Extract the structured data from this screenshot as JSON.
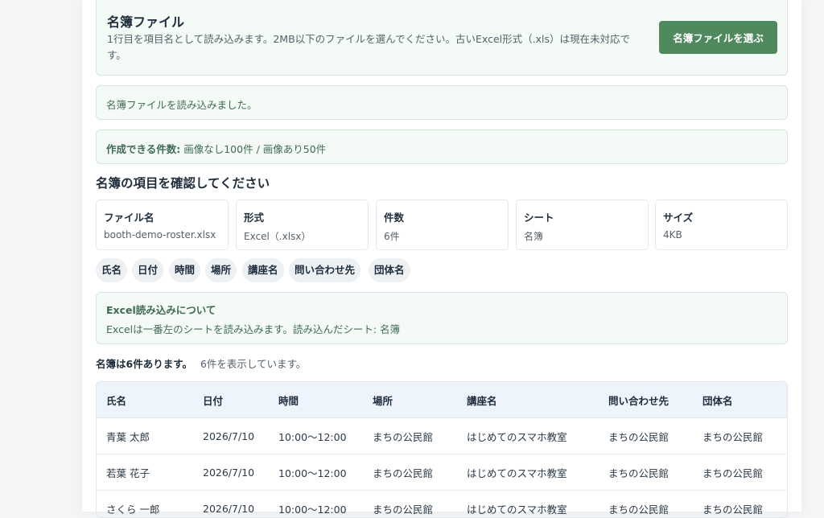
{
  "upload": {
    "title": "名簿ファイル",
    "description": "1行目を項目名として読み込みます。2MB以下のファイルを選んでください。古いExcel形式（.xls）は現在未対応です。",
    "button_label": "名簿ファイルを選ぶ"
  },
  "status_message": "名簿ファイルを読み込みました。",
  "capacity": {
    "label": "作成できる件数:",
    "value": "画像なし100件 / 画像あり50件"
  },
  "section_title": "名簿の項目を確認してください",
  "file_info": [
    {
      "key": "ファイル名",
      "value": "booth-demo-roster.xlsx"
    },
    {
      "key": "形式",
      "value": "Excel（.xlsx）"
    },
    {
      "key": "件数",
      "value": "6件"
    },
    {
      "key": "シート",
      "value": "名簿"
    },
    {
      "key": "サイズ",
      "value": "4KB"
    }
  ],
  "fields": [
    "氏名",
    "日付",
    "時間",
    "場所",
    "講座名",
    "問い合わせ先",
    "団体名"
  ],
  "excel_note": {
    "heading": "Excel読み込みについて",
    "text": "Excelは一番左のシートを読み込みます。読み込んだシート: 名簿"
  },
  "summary": {
    "total": "名簿は6件あります。",
    "shown": "6件を表示しています。"
  },
  "table": {
    "headers": [
      "氏名",
      "日付",
      "時間",
      "場所",
      "講座名",
      "問い合わせ先",
      "団体名"
    ],
    "rows": [
      [
        "青葉 太郎",
        "2026/7/10",
        "10:00〜12:00",
        "まちの公民館",
        "はじめてのスマホ教室",
        "まちの公民館",
        "まちの公民館"
      ],
      [
        "若葉 花子",
        "2026/7/10",
        "10:00〜12:00",
        "まちの公民館",
        "はじめてのスマホ教室",
        "まちの公民館",
        "まちの公民館"
      ],
      [
        "さくら 一郎",
        "2026/7/10",
        "10:00〜12:00",
        "まちの公民館",
        "はじめてのスマホ教室",
        "まちの公民館",
        "まちの公民館"
      ]
    ]
  },
  "colors": {
    "accent_button": "#4f8a5e",
    "notice_bg": "#f4faf6",
    "notice_text": "#3f6b52",
    "table_header_bg": "#edf4fb"
  }
}
